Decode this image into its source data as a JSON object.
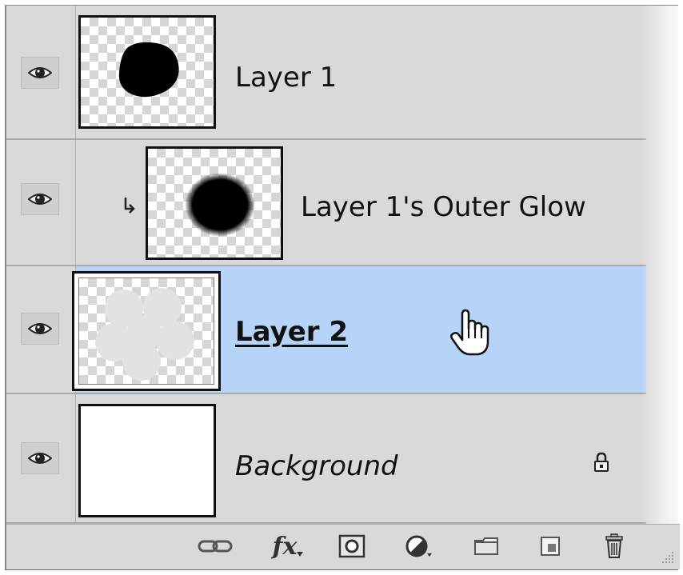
{
  "layers": [
    {
      "name": "Layer 1",
      "visible": true,
      "thumbnail": "black-blob-on-transparency"
    },
    {
      "name": "Layer 1's Outer Glow",
      "visible": true,
      "clipped": true,
      "thumbnail": "soft-black-blob-on-transparency"
    },
    {
      "name": "Layer 2",
      "visible": true,
      "selected": true,
      "thumbnail": "light-circles-on-transparency"
    },
    {
      "name": "Background",
      "visible": true,
      "locked": true,
      "thumbnail": "white-fill"
    }
  ],
  "footer_tools": [
    "link-layers-icon",
    "add-layer-style-icon",
    "add-layer-mask-icon",
    "new-adjustment-layer-icon",
    "new-group-icon",
    "new-layer-icon",
    "delete-layer-icon"
  ],
  "footer": {
    "fx_label": "fx"
  },
  "colors": {
    "panel_bg": "#d9d9d9",
    "selected_row": "#b6d4f8",
    "row_divider": "#a9a9a9"
  }
}
